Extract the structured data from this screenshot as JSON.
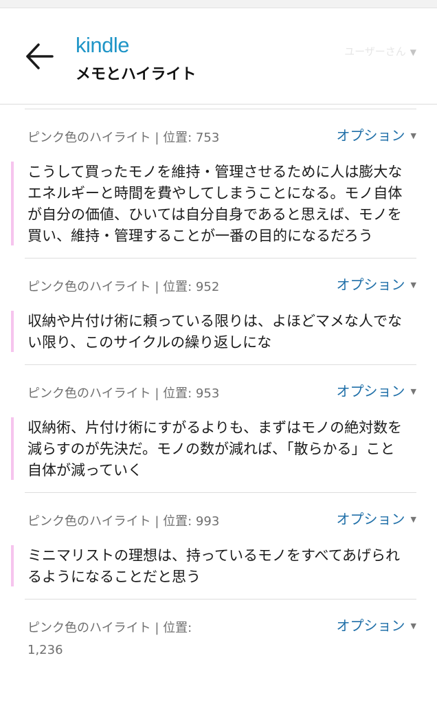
{
  "header": {
    "brand": "kindle",
    "title": "メモとハイライト",
    "user_label": "ユーザーさん"
  },
  "option_label": "オプション",
  "highlights": [
    {
      "meta": "ピンク色のハイライト | 位置: 753",
      "text": "こうして買ったモノを維持・管理させるために人は膨大なエネルギーと時間を費やしてしまうことになる。モノ自体が自分の価値、ひいては自分自身であると思えば、モノを買い、維持・管理することが一番の目的になるだろう"
    },
    {
      "meta": "ピンク色のハイライト | 位置: 952",
      "text": "収納や片付け術に頼っている限りは、よほどマメな人でない限り、このサイクルの繰り返しにな"
    },
    {
      "meta": "ピンク色のハイライト | 位置: 953",
      "text": "収納術、片付け術にすがるよりも、まずはモノの絶対数を減らすのが先決だ。モノの数が減れば、「散らかる」こと自体が減っていく"
    },
    {
      "meta": "ピンク色のハイライト | 位置: 993",
      "text": "ミニマリストの理想は、持っているモノをすべてあげられるようになることだと思う"
    },
    {
      "meta": "ピンク色のハイライト | 位置: 1,236",
      "text": ""
    }
  ],
  "colors": {
    "brand": "#1f95c7",
    "highlight_bar": "#f6c4ee",
    "link": "#1f6fa8"
  }
}
